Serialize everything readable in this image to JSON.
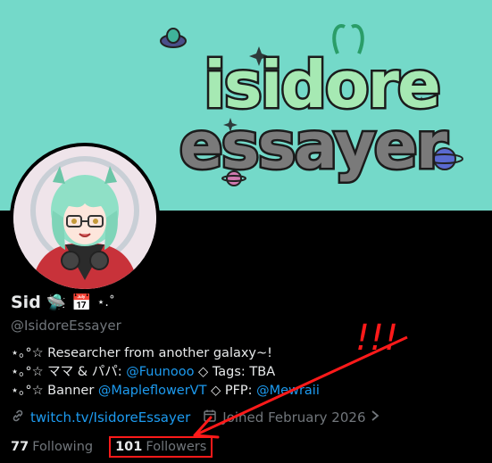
{
  "banner": {
    "title_line1": "isidore",
    "title_line2": "essayer"
  },
  "profile": {
    "name": "Sid",
    "name_emojis": [
      "🛸",
      "📅",
      "⋆.˚"
    ],
    "handle": "@IsidoreEssayer",
    "bio": {
      "line1": "⋆｡°☆ Researcher from another galaxy~!",
      "line2_prefix": "⋆｡°☆ ママ & パパ: ",
      "line2_link": "@Fuunooo",
      "line2_suffix": " ◇ Tags: TBA",
      "line3_prefix": "⋆｡°☆ Banner ",
      "line3_link1": "@MapleflowerVT",
      "line3_mid": " ◇ PFP: ",
      "line3_link2": "@Mewraii"
    },
    "website": "twitch.tv/IsidoreEssayer",
    "joined": "Joined February 2026",
    "following_count": "77",
    "following_label": "Following",
    "followers_count": "101",
    "followers_label": "Followers"
  },
  "annotation": {
    "text": "!!!",
    "color": "#ff1a1a"
  },
  "colors": {
    "banner_bg": "#74d9c9",
    "link": "#1d9bf0",
    "muted": "#71767b"
  }
}
